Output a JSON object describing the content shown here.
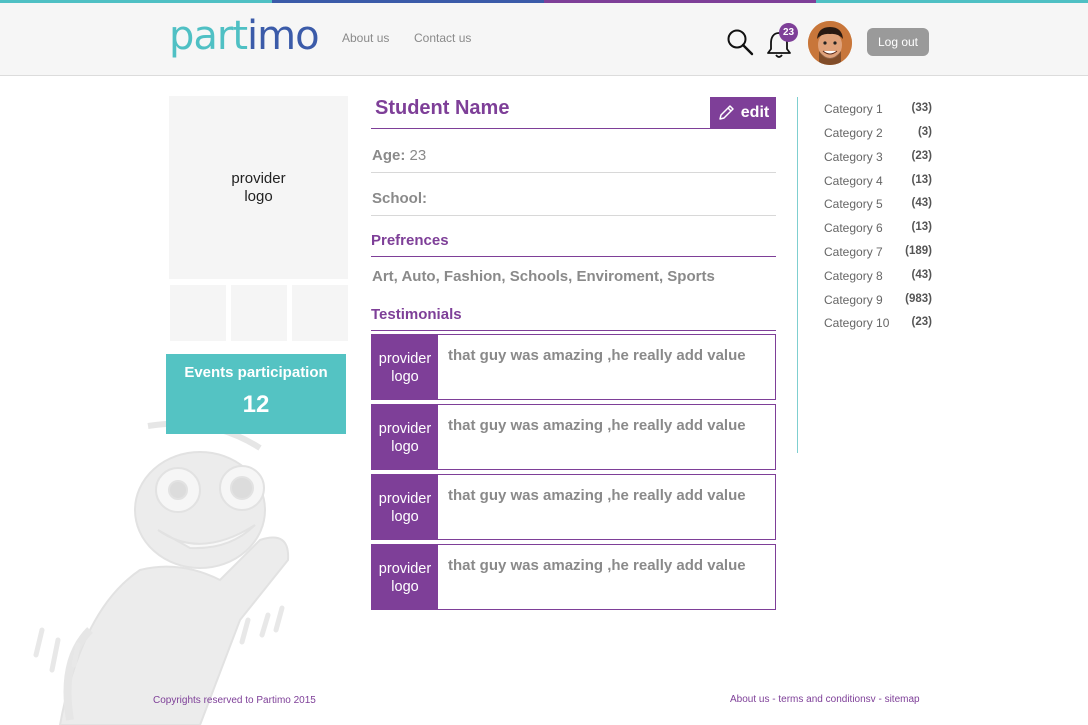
{
  "colors": {
    "purple": "#7e3f98",
    "teal": "#54c3c3",
    "strip": [
      "#4fc0c4",
      "#3b5ba9",
      "#7e3f98",
      "#4fc0c4"
    ]
  },
  "header": {
    "logo_part1": "part",
    "logo_part2": "imo",
    "nav": [
      "About us",
      "Contact us"
    ],
    "notification_count": "23",
    "logout_label": "Log out",
    "icons": [
      "search-icon",
      "bell-icon",
      "avatar"
    ]
  },
  "left": {
    "provider_logo_line1": "provider",
    "provider_logo_line2": "logo",
    "events_title": "Events participation",
    "events_count": "12"
  },
  "profile": {
    "name": "Student Name",
    "edit_label": "edit",
    "age_label": "Age:",
    "age_value": "23",
    "school_label": "School:",
    "preferences_title": "Prefrences",
    "preferences": "Art, Auto, Fashion, Schools, Enviroment, Sports",
    "testimonials_title": "Testimonials",
    "testimonials": [
      {
        "logo_line1": "provider",
        "logo_line2": "logo",
        "text": "that guy was amazing ,he really add value"
      },
      {
        "logo_line1": "provider",
        "logo_line2": "logo",
        "text": "that guy was amazing ,he really add value"
      },
      {
        "logo_line1": "provider",
        "logo_line2": "logo",
        "text": "that guy was amazing ,he really add value"
      },
      {
        "logo_line1": "provider",
        "logo_line2": "logo",
        "text": "that guy was amazing ,he really add value"
      }
    ]
  },
  "categories": [
    {
      "name": "Category 1",
      "count": "(33)"
    },
    {
      "name": "Category 2",
      "count": "(3)"
    },
    {
      "name": "Category 3",
      "count": "(23)"
    },
    {
      "name": "Category 4",
      "count": "(13)"
    },
    {
      "name": "Category 5",
      "count": "(43)"
    },
    {
      "name": "Category 6",
      "count": "(13)"
    },
    {
      "name": "Category 7",
      "count": "(189)"
    },
    {
      "name": "Category 8",
      "count": "(43)"
    },
    {
      "name": "Category 9",
      "count": "(983)"
    },
    {
      "name": "Category 10",
      "count": "(23)"
    }
  ],
  "footer": {
    "copyright": "Copyrights reserved to Partimo 2015",
    "about": "About us",
    "sep1": "-",
    "terms": "terms and conditionsv",
    "sep2": "-",
    "sitemap": "sitemap"
  }
}
